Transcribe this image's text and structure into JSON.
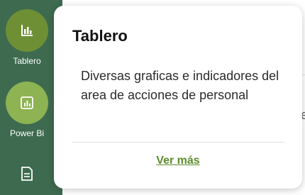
{
  "sidebar": {
    "items": [
      {
        "label": "Tablero",
        "icon": "bar-chart-icon",
        "color": "#6f8f35"
      },
      {
        "label": "Power Bi",
        "icon": "report-chart-icon",
        "color": "#8db352"
      },
      {
        "label": "",
        "icon": "document-icon"
      }
    ],
    "background": "#3e6b4f"
  },
  "popover": {
    "title": "Tablero",
    "description": "Diversas graficas e indicadores del area de acciones de personal",
    "link_label": "Ver más",
    "link_color": "#5d8a2b"
  },
  "background_content": {
    "partial_char": "e"
  }
}
